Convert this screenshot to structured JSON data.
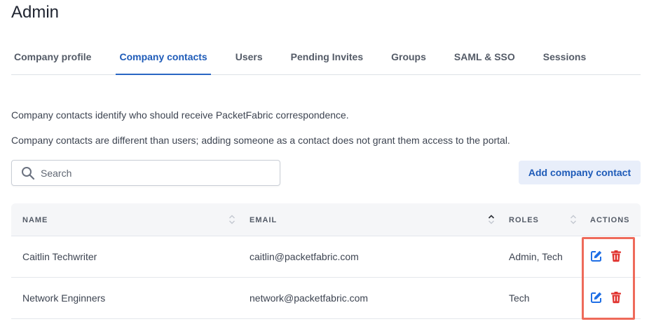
{
  "page": {
    "title": "Admin"
  },
  "tabs": [
    {
      "label": "Company profile"
    },
    {
      "label": "Company contacts",
      "active": true
    },
    {
      "label": "Users"
    },
    {
      "label": "Pending Invites"
    },
    {
      "label": "Groups"
    },
    {
      "label": "SAML & SSO"
    },
    {
      "label": "Sessions"
    }
  ],
  "description": {
    "line1": "Company contacts identify who should receive PacketFabric correspondence.",
    "line2": "Company contacts are different than users; adding someone as a contact does not grant them access to the portal."
  },
  "search": {
    "placeholder": "Search",
    "value": "",
    "icon": "search-icon"
  },
  "add_button": {
    "label": "Add company contact"
  },
  "table": {
    "columns": [
      {
        "label": "NAME",
        "sort_icon": "sort-icon"
      },
      {
        "label": "EMAIL",
        "sort_icon": "sort-ascending-icon"
      },
      {
        "label": "ROLES",
        "sort_icon": "sort-icon"
      },
      {
        "label": "ACTIONS"
      }
    ],
    "rows": [
      {
        "name": "Caitlin Techwriter",
        "email": "caitlin@packetfabric.com",
        "roles": "Admin, Tech"
      },
      {
        "name": "Network Enginners",
        "email": "network@packetfabric.com",
        "roles": "Tech"
      }
    ],
    "action_icons": [
      "edit-icon",
      "trash-icon"
    ]
  },
  "colors": {
    "accent": "#1e5bb8",
    "edit_icon": "#1f6fe5",
    "delete_icon": "#e0322e",
    "highlight": "#ee6a5a"
  }
}
